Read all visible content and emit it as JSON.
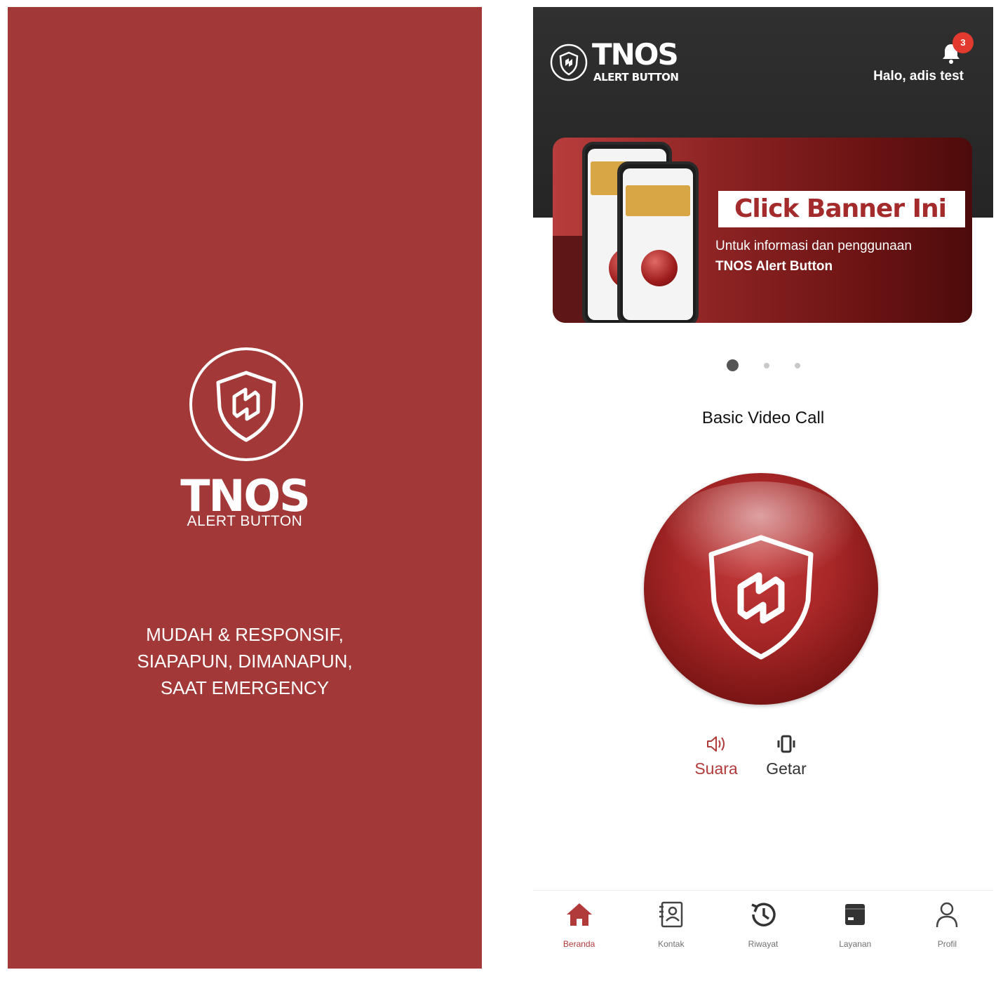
{
  "splash": {
    "brand": "TNOS",
    "sub": "ALERT BUTTON",
    "tagline": [
      "MUDAH & RESPONSIF,",
      "SIAPAPUN, DIMANAPUN,",
      "SAAT EMERGENCY"
    ]
  },
  "header": {
    "brand": "TNOS",
    "sub": "ALERT BUTTON",
    "notification_count": "3",
    "greeting": "Halo, adis test"
  },
  "banner": {
    "title": "Click Banner Ini",
    "desc_line1": "Untuk informasi dan penggunaan",
    "desc_line2": "TNOS Alert Button"
  },
  "carousel": {
    "total": 3,
    "active_index": 0
  },
  "mode_label": "Basic Video Call",
  "toggles": {
    "sound": {
      "label": "Suara",
      "active": true
    },
    "vibrate": {
      "label": "Getar",
      "active": false
    }
  },
  "bottom_nav": [
    {
      "label": "Beranda",
      "icon": "home-icon",
      "active": true
    },
    {
      "label": "Kontak",
      "icon": "contacts-icon",
      "active": false
    },
    {
      "label": "Riwayat",
      "icon": "history-icon",
      "active": false
    },
    {
      "label": "Layanan",
      "icon": "services-icon",
      "active": false
    },
    {
      "label": "Profil",
      "icon": "profile-icon",
      "active": false
    }
  ],
  "colors": {
    "brand_red": "#a23837",
    "active_red": "#b13a3a",
    "header_dark": "#2b2b2b"
  }
}
